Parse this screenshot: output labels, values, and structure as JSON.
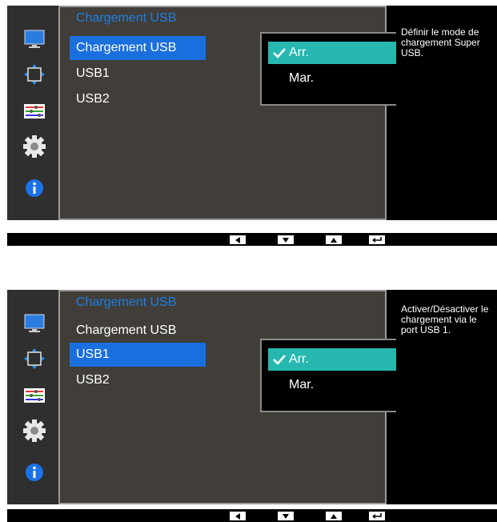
{
  "colors": {
    "panel_bg": "#413d39",
    "sidebar_bg": "#2f2f2f",
    "title_blue": "#1e7fe0",
    "highlight_blue": "#1a6fde",
    "selected_teal": "#26b8b0"
  },
  "sidebar_icons": [
    "monitor-icon",
    "position-arrows-icon",
    "color-adjust-icon",
    "gear-icon",
    "info-icon"
  ],
  "screens": [
    {
      "menu": {
        "title": "Chargement USB",
        "items": [
          "Chargement USB",
          "USB1",
          "USB2"
        ],
        "active_index": 0
      },
      "submenu": {
        "options": [
          "Arr.",
          "Mar."
        ],
        "selected_index": 0
      },
      "description": [
        "Définir le mode de",
        "chargement Super",
        "USB."
      ]
    },
    {
      "menu": {
        "title": "Chargement USB",
        "items": [
          "Chargement USB",
          "USB1",
          "USB2"
        ],
        "active_index": 1
      },
      "submenu": {
        "options": [
          "Arr.",
          "Mar."
        ],
        "selected_index": 0
      },
      "description": [
        "Activer/Désactiver le",
        "chargement via le",
        "port USB 1."
      ]
    }
  ],
  "nav_buttons": [
    "left-arrow-icon",
    "down-arrow-icon",
    "up-arrow-icon",
    "enter-icon"
  ]
}
